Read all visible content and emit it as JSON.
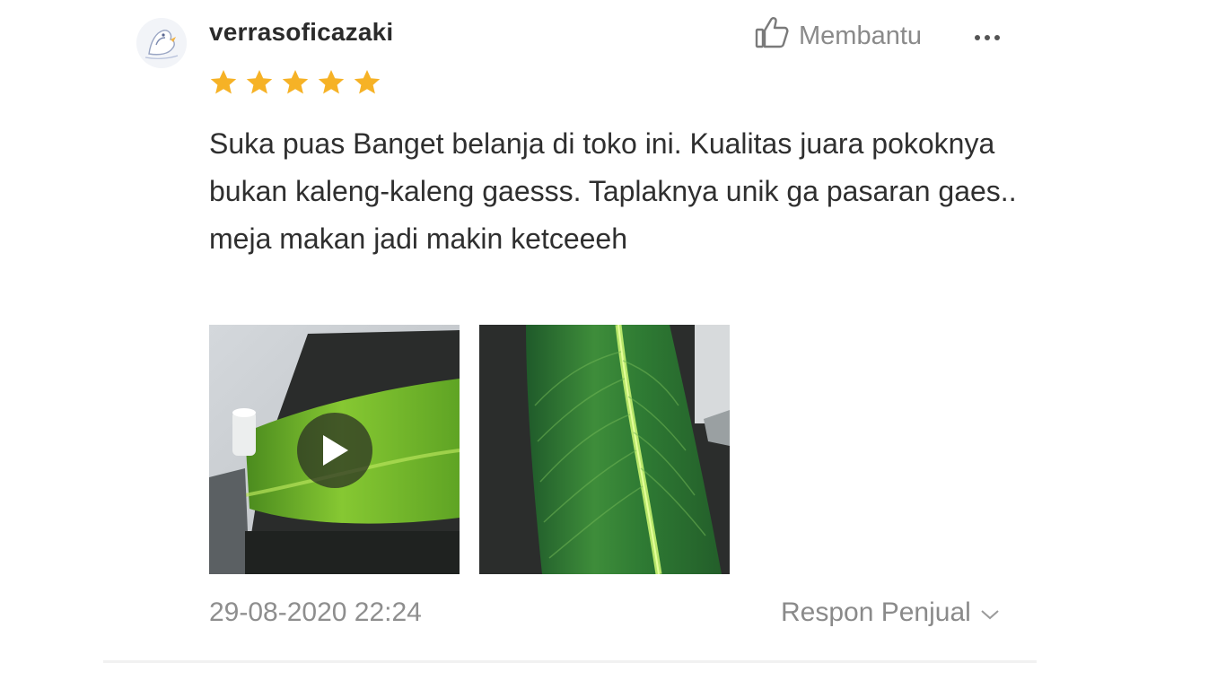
{
  "review": {
    "username": "verrasoficazaki",
    "rating": 5,
    "rating_max": 5,
    "text": "Suka puas Banget belanja di toko ini. Kualitas juara pokoknya bukan kaleng-kaleng gaesss. Taplaknya unik ga pasaran gaes.. meja makan jadi makin ketceeeh",
    "timestamp": "29-08-2020 22:24"
  },
  "actions": {
    "helpful_label": "Membantu",
    "helpful_icon": "thumbs-up-icon",
    "more_icon": "more-horizontal-icon",
    "seller_response_label": "Respon Penjual",
    "seller_response_icon": "chevron-down-icon"
  },
  "media": [
    {
      "type": "video",
      "icon": "play-icon"
    },
    {
      "type": "photo"
    }
  ],
  "colors": {
    "star": "#f6b226",
    "text": "#2f2f2f",
    "muted": "#8e8e8e"
  }
}
